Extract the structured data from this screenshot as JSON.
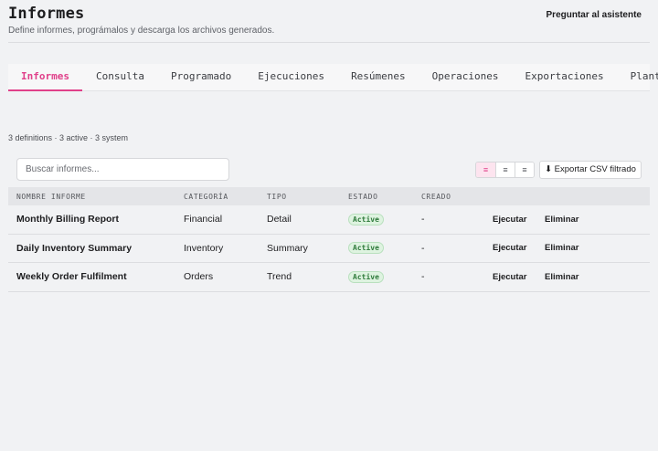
{
  "header": {
    "title": "Informes",
    "subtitle": "Define informes, prográmalos y descarga los archivos generados.",
    "assistant_label": "Preguntar al asistente"
  },
  "tabs": [
    {
      "label": "Informes",
      "active": true
    },
    {
      "label": "Consulta",
      "active": false
    },
    {
      "label": "Programado",
      "active": false
    },
    {
      "label": "Ejecuciones",
      "active": false
    },
    {
      "label": "Resúmenes",
      "active": false
    },
    {
      "label": "Operaciones",
      "active": false
    },
    {
      "label": "Exportaciones",
      "active": false
    },
    {
      "label": "Plantillas",
      "active": false
    }
  ],
  "summary": "3 definitions · 3 active · 3 system",
  "search": {
    "placeholder": "Buscar informes...",
    "value": ""
  },
  "view_toggle": {
    "icons": [
      "≡",
      "≡",
      "≡"
    ],
    "active_index": 0
  },
  "export_label": "⬇ Exportar CSV filtrado",
  "table": {
    "columns": [
      "NOMBRE INFORME",
      "CATEGORÍA",
      "TIPO",
      "ESTADO",
      "CREADO",
      "",
      ""
    ],
    "rows": [
      {
        "name": "Monthly Billing Report",
        "category": "Financial",
        "type": "Detail",
        "status": "Active",
        "created": "-",
        "run": "Ejecutar",
        "delete": "Eliminar"
      },
      {
        "name": "Daily Inventory Summary",
        "category": "Inventory",
        "type": "Summary",
        "status": "Active",
        "created": "-",
        "run": "Ejecutar",
        "delete": "Eliminar"
      },
      {
        "name": "Weekly Order Fulfilment",
        "category": "Orders",
        "type": "Trend",
        "status": "Active",
        "created": "-",
        "run": "Ejecutar",
        "delete": "Eliminar"
      }
    ]
  },
  "colors": {
    "accent": "#e0408a",
    "status_active": "#2f7a3b"
  }
}
